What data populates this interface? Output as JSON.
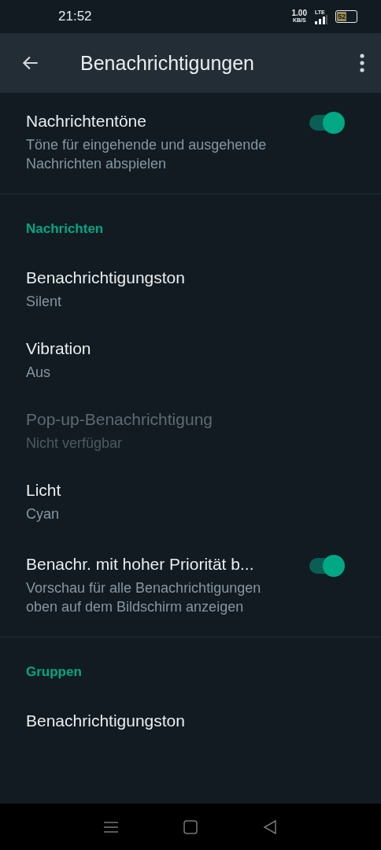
{
  "status_bar": {
    "time": "21:52",
    "speed": "1.00",
    "speed_unit": "KB/S",
    "network": "LTE",
    "battery": "52"
  },
  "app_bar": {
    "title": "Benachrichtigungen"
  },
  "items": [
    {
      "kind": "toggle",
      "title": "Nachrichtentöne",
      "subtitle": "Töne für eingehende und ausgehende Nachrichten abspielen",
      "on": true,
      "disabled": false
    },
    {
      "kind": "divider"
    },
    {
      "kind": "header",
      "title": "Nachrichten"
    },
    {
      "kind": "option",
      "title": "Benachrichtigungston",
      "subtitle": "Silent",
      "disabled": false
    },
    {
      "kind": "option",
      "title": "Vibration",
      "subtitle": "Aus",
      "disabled": false
    },
    {
      "kind": "option",
      "title": "Pop-up-Benachrichtigung",
      "subtitle": "Nicht verfügbar",
      "disabled": true
    },
    {
      "kind": "option",
      "title": "Licht",
      "subtitle": "Cyan",
      "disabled": false
    },
    {
      "kind": "toggle",
      "title": "Benachr. mit hoher Priorität b...",
      "subtitle": "Vorschau für alle Benachrichtigungen oben auf dem Bildschirm anzeigen",
      "on": true,
      "disabled": false
    },
    {
      "kind": "divider"
    },
    {
      "kind": "header",
      "title": "Gruppen"
    },
    {
      "kind": "option",
      "title": "Benachrichtigungston",
      "disabled": false
    }
  ]
}
